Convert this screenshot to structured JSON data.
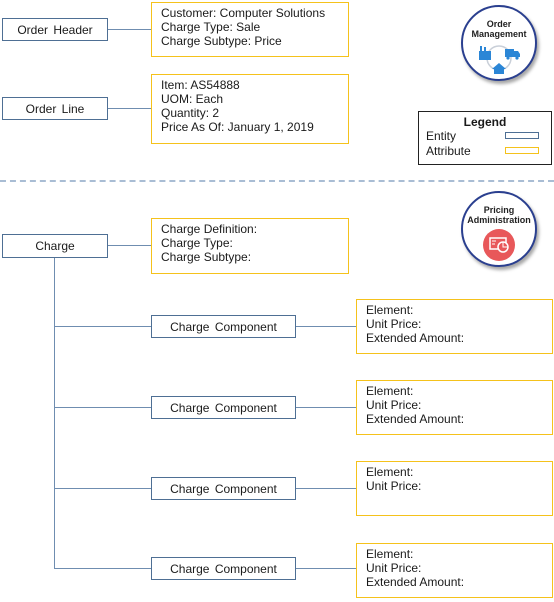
{
  "order_section": {
    "order_header": {
      "label": "Order Header",
      "attributes": [
        "Customer: Computer Solutions",
        "Charge Type: Sale",
        "Charge Subtype: Price"
      ]
    },
    "order_line": {
      "label": "Order Line",
      "attributes": [
        "Item: AS54888",
        "UOM: Each",
        "Quantity: 2",
        "Price As Of: January 1, 2019"
      ]
    },
    "badge": {
      "line1": "Order",
      "line2": "Management"
    }
  },
  "legend": {
    "title": "Legend",
    "entity_label": "Entity",
    "attribute_label": "Attribute",
    "entity_color": "#4e6f94",
    "attribute_color": "#f5c21b"
  },
  "pricing_section": {
    "badge": {
      "line1": "Pricing",
      "line2": "Administration",
      "icon_color": "#e8585a"
    },
    "charge": {
      "label": "Charge",
      "attributes": [
        "Charge Definition:",
        "Charge Type:",
        "Charge Subtype:"
      ]
    },
    "components": [
      {
        "label": "Charge Component",
        "attributes": [
          "Element:",
          "Unit Price:",
          "Extended Amount:"
        ]
      },
      {
        "label": "Charge Component",
        "attributes": [
          "Element:",
          "Unit Price:",
          "Extended Amount:"
        ]
      },
      {
        "label": "Charge Component",
        "attributes": [
          "Element:",
          "Unit Price:"
        ]
      },
      {
        "label": "Charge Component",
        "attributes": [
          "Element:",
          "Unit Price:",
          "Extended Amount:"
        ]
      }
    ]
  }
}
